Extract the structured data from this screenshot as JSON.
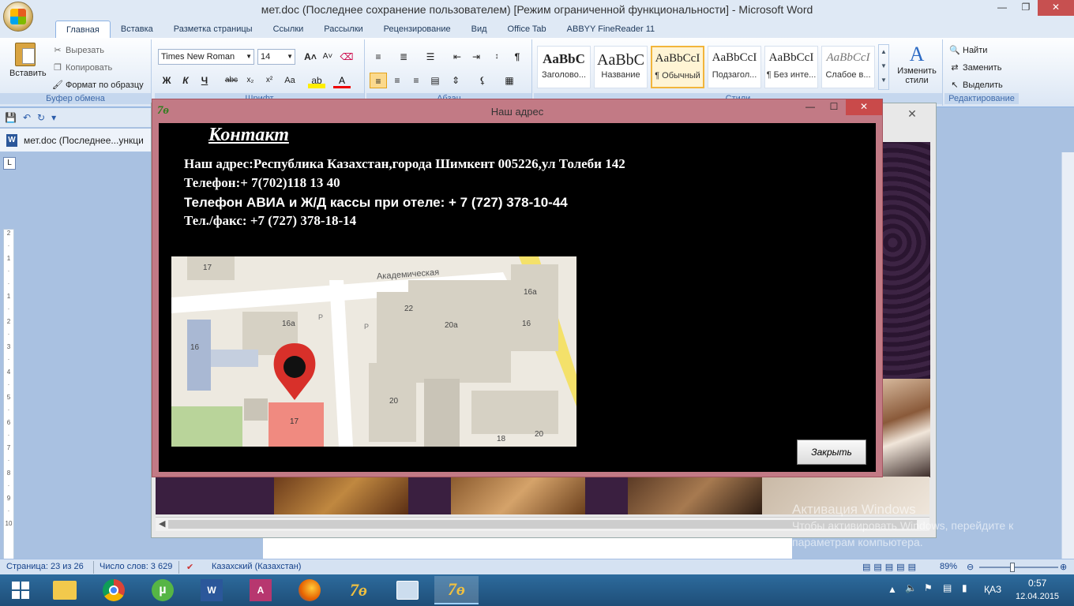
{
  "word": {
    "title": "мет.doc (Последнее сохранение пользователем) [Режим ограниченной функциональности] - Microsoft Word",
    "tabs": [
      "Главная",
      "Вставка",
      "Разметка страницы",
      "Ссылки",
      "Рассылки",
      "Рецензирование",
      "Вид",
      "Office Tab",
      "ABBYY FineReader 11"
    ],
    "clipboard": {
      "paste": "Вставить",
      "cut": "Вырезать",
      "copy": "Копировать",
      "format_painter": "Формат по образцу",
      "label": "Буфер обмена"
    },
    "font": {
      "name": "Times New Roman",
      "size": "14",
      "group_label": "Шрифт"
    },
    "paragraph_label": "Абзац",
    "styles": [
      {
        "sample": "AaBbC",
        "name": "Заголово..."
      },
      {
        "sample": "AaBbC",
        "name": "Название"
      },
      {
        "sample": "AaBbCcI",
        "name": "¶ Обычный"
      },
      {
        "sample": "AaBbCcI",
        "name": "Подзагол..."
      },
      {
        "sample": "AaBbCcI",
        "name": "¶ Без инте..."
      },
      {
        "sample": "AaBbCcI",
        "name": "Слабое в..."
      }
    ],
    "styles_label": "Стили",
    "change_styles": "Изменить стили",
    "editing": {
      "find": "Найти",
      "replace": "Заменить",
      "select": "Выделить",
      "label": "Редактирование"
    },
    "doc_tab": "мет.doc (Последнее...ункци",
    "status": {
      "page": "Страница: 23 из 26",
      "words": "Число слов: 3 629",
      "language": "Казахский (Казахстан)",
      "zoom": "89%"
    }
  },
  "dialog": {
    "title": "Наш адрес",
    "heading": "Контакт",
    "address": "Наш адрес:Республика Казахстан,города Шимкент 005226,ул Толеби 142",
    "phone": "Телефон:+ 7(702)118 13 40",
    "avia": "Телефон АВИА и Ж/Д кассы при отеле: + 7 (727) 378-10-44",
    "fax": "Тел./факс: +7 (727) 378-18-14",
    "close_button": "Закрыть",
    "map": {
      "street": "Академическая",
      "labels": [
        "17",
        "16а",
        "16",
        "22",
        "20а",
        "16а",
        "16",
        "20",
        "17",
        "18",
        "20",
        "P",
        "P"
      ]
    }
  },
  "watermark": {
    "line1": "Активация Windows",
    "line2": "Чтобы активировать Windows, перейдите к",
    "line3": "параметрам компьютера."
  },
  "taskbar": {
    "lang": "ҚАЗ",
    "time": "0:57",
    "date": "12.04.2015"
  },
  "colors": {
    "dialog_frame": "#c27a85",
    "taskbar": "#1e4e78",
    "ribbon_accent": "#3e6aaa"
  }
}
